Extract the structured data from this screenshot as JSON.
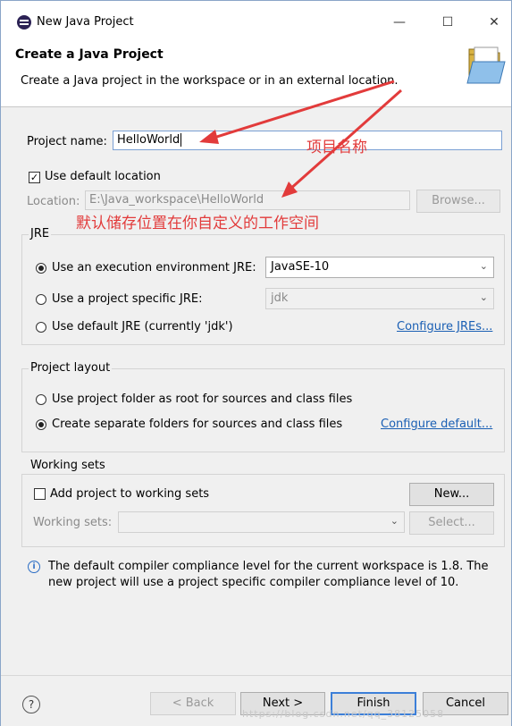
{
  "window": {
    "title": "New Java Project",
    "minimize_glyph": "—",
    "maximize_glyph": "☐",
    "close_glyph": "✕"
  },
  "header": {
    "title": "Create a Java Project",
    "description": "Create a Java project in the workspace or in an external location."
  },
  "project": {
    "name_label": "Project name:",
    "name_value": "HelloWorld",
    "use_default_location_label": "Use default location",
    "use_default_location_checked": true,
    "location_label": "Location:",
    "location_value": "E:\\Java_workspace\\HelloWorld",
    "browse_label": "Browse..."
  },
  "annotations": {
    "project_name_note": "项目名称",
    "location_note": "默认储存位置在你自定义的工作空间",
    "color": "#e23b3b"
  },
  "jre": {
    "title": "JRE",
    "option_env_label": "Use an execution environment JRE:",
    "option_env_selected": true,
    "env_value": "JavaSE-10",
    "option_specific_label": "Use a project specific JRE:",
    "specific_value": "jdk",
    "option_default_label": "Use default JRE (currently 'jdk')",
    "configure_link": "Configure JREs..."
  },
  "layout": {
    "title": "Project layout",
    "option_root_label": "Use project folder as root for sources and class files",
    "option_separate_label": "Create separate folders for sources and class files",
    "option_separate_selected": true,
    "configure_link": "Configure default..."
  },
  "working_sets": {
    "title": "Working sets",
    "add_label": "Add project to working sets",
    "add_checked": false,
    "new_button": "New...",
    "sets_label": "Working sets:",
    "select_button": "Select..."
  },
  "info": {
    "message_line1": "The default compiler compliance level for the current workspace is 1.8. The",
    "message_line2": "new project will use a project specific compiler compliance level of 10."
  },
  "footer": {
    "help_glyph": "?",
    "back_button": "< Back",
    "next_button": "Next >",
    "finish_button": "Finish",
    "cancel_button": "Cancel"
  },
  "watermark": "https://blog.csdn.net/qq_38125058"
}
